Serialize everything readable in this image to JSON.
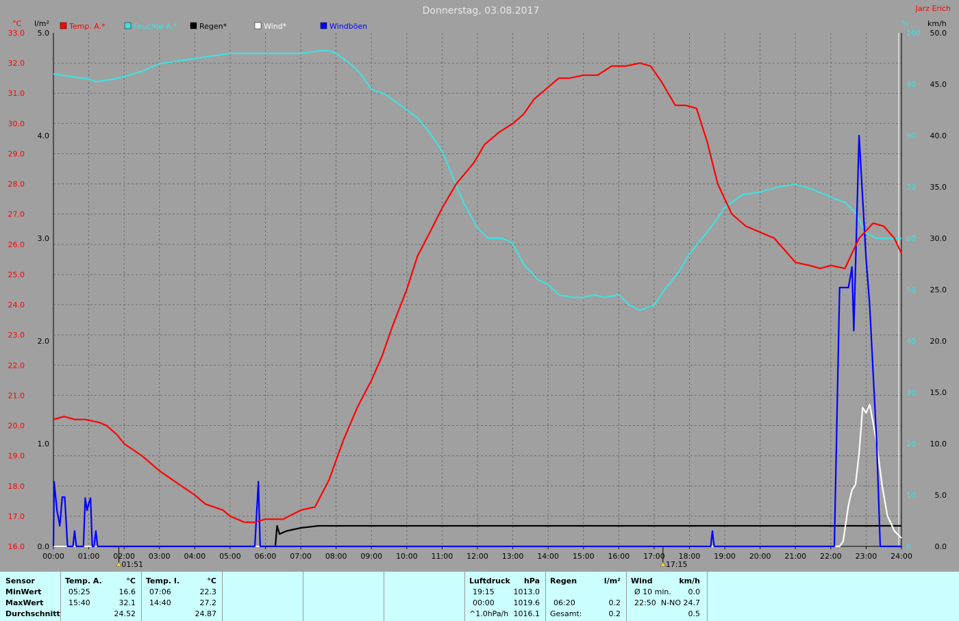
{
  "title": "Donnerstag, 03.08.2017",
  "author": "Jarz Erich",
  "axes": {
    "left1_unit": "°C",
    "left2_unit": "l/m²",
    "right1_unit": "%",
    "right2_unit": "km/h",
    "temp_ticks": [
      "16.0",
      "17.0",
      "18.0",
      "19.0",
      "20.0",
      "21.0",
      "22.0",
      "23.0",
      "24.0",
      "25.0",
      "26.0",
      "27.0",
      "28.0",
      "29.0",
      "30.0",
      "31.0",
      "32.0",
      "33.0"
    ],
    "rain_ticks": [
      "0.0",
      "1.0",
      "2.0",
      "3.0",
      "4.0",
      "5.0"
    ],
    "hum_ticks": [
      "0",
      "10",
      "20",
      "30",
      "40",
      "50",
      "60",
      "70",
      "80",
      "90",
      "100"
    ],
    "wind_ticks": [
      "0.0",
      "5.0",
      "10.0",
      "15.0",
      "20.0",
      "25.0",
      "30.0",
      "35.0",
      "40.0",
      "45.0",
      "50.0"
    ],
    "x_ticks": [
      "00:00",
      "01:00",
      "02:00",
      "03:00",
      "04:00",
      "05:00",
      "06:00",
      "07:00",
      "08:00",
      "09:00",
      "10:00",
      "11:00",
      "12:00",
      "13:00",
      "14:00",
      "15:00",
      "16:00",
      "17:00",
      "18:00",
      "19:00",
      "20:00",
      "21:00",
      "22:00",
      "23:00",
      "24:00"
    ],
    "sunrise": "01:51",
    "sunset": "17:15"
  },
  "legend": [
    {
      "name": "Temp. A.*",
      "color": "#ff0000"
    },
    {
      "name": "Feuchte A.*",
      "color": "#40e0e0"
    },
    {
      "name": "Regen*",
      "color": "#000000"
    },
    {
      "name": "Wind*",
      "color": "#ffffff"
    },
    {
      "name": "Windböen",
      "color": "#0000ff"
    }
  ],
  "chart_data": {
    "type": "line",
    "title": "Donnerstag, 03.08.2017",
    "x_unit": "hour of day",
    "xlim": [
      0,
      24
    ],
    "series": [
      {
        "name": "Temp. A.*",
        "axis": "°C",
        "ylim": [
          16,
          33
        ],
        "color": "#ff0000",
        "points": [
          [
            0,
            20.2
          ],
          [
            0.3,
            20.3
          ],
          [
            0.6,
            20.2
          ],
          [
            0.9,
            20.2
          ],
          [
            1.3,
            20.1
          ],
          [
            1.5,
            20.0
          ],
          [
            1.8,
            19.7
          ],
          [
            2.0,
            19.4
          ],
          [
            2.5,
            19.0
          ],
          [
            3.0,
            18.5
          ],
          [
            3.5,
            18.1
          ],
          [
            4.0,
            17.7
          ],
          [
            4.3,
            17.4
          ],
          [
            4.8,
            17.2
          ],
          [
            5.0,
            17.0
          ],
          [
            5.4,
            16.8
          ],
          [
            5.7,
            16.8
          ],
          [
            6.0,
            16.9
          ],
          [
            6.5,
            16.9
          ],
          [
            7.0,
            17.2
          ],
          [
            7.4,
            17.3
          ],
          [
            7.8,
            18.2
          ],
          [
            8.2,
            19.5
          ],
          [
            8.6,
            20.6
          ],
          [
            9.0,
            21.5
          ],
          [
            9.3,
            22.3
          ],
          [
            9.6,
            23.3
          ],
          [
            10.0,
            24.5
          ],
          [
            10.3,
            25.6
          ],
          [
            10.7,
            26.5
          ],
          [
            11.0,
            27.2
          ],
          [
            11.4,
            28.0
          ],
          [
            11.9,
            28.7
          ],
          [
            12.2,
            29.3
          ],
          [
            12.6,
            29.7
          ],
          [
            13.0,
            30.0
          ],
          [
            13.3,
            30.3
          ],
          [
            13.6,
            30.8
          ],
          [
            14.0,
            31.2
          ],
          [
            14.3,
            31.5
          ],
          [
            14.6,
            31.5
          ],
          [
            15.0,
            31.6
          ],
          [
            15.4,
            31.6
          ],
          [
            15.8,
            31.9
          ],
          [
            16.2,
            31.9
          ],
          [
            16.6,
            32.0
          ],
          [
            16.9,
            31.9
          ],
          [
            17.2,
            31.4
          ],
          [
            17.6,
            30.6
          ],
          [
            17.9,
            30.6
          ],
          [
            18.2,
            30.5
          ],
          [
            18.5,
            29.4
          ],
          [
            18.8,
            28.0
          ],
          [
            19.2,
            27.0
          ],
          [
            19.6,
            26.6
          ],
          [
            20.0,
            26.4
          ],
          [
            20.4,
            26.2
          ],
          [
            20.7,
            25.8
          ],
          [
            21.0,
            25.4
          ],
          [
            21.4,
            25.3
          ],
          [
            21.7,
            25.2
          ],
          [
            22.0,
            25.3
          ],
          [
            22.4,
            25.2
          ],
          [
            22.8,
            26.2
          ],
          [
            23.2,
            26.7
          ],
          [
            23.5,
            26.6
          ],
          [
            23.8,
            26.2
          ],
          [
            24.0,
            25.7
          ]
        ]
      },
      {
        "name": "Feuchte A.*",
        "axis": "%",
        "ylim": [
          0,
          100
        ],
        "color": "#40e0e0",
        "points": [
          [
            0,
            92
          ],
          [
            0.5,
            91.5
          ],
          [
            1.0,
            91
          ],
          [
            1.2,
            90.5
          ],
          [
            1.7,
            91
          ],
          [
            2.0,
            91.5
          ],
          [
            2.5,
            92.5
          ],
          [
            3.0,
            94
          ],
          [
            3.5,
            94.5
          ],
          [
            4.0,
            95
          ],
          [
            4.5,
            95.5
          ],
          [
            5.0,
            96
          ],
          [
            5.5,
            96
          ],
          [
            6.0,
            96
          ],
          [
            6.5,
            96
          ],
          [
            7.0,
            96
          ],
          [
            7.5,
            96.5
          ],
          [
            7.8,
            96.5
          ],
          [
            8.0,
            96
          ],
          [
            8.4,
            94
          ],
          [
            8.7,
            92
          ],
          [
            9.0,
            89
          ],
          [
            9.4,
            88
          ],
          [
            9.7,
            86.5
          ],
          [
            10.0,
            85
          ],
          [
            10.3,
            83.5
          ],
          [
            10.6,
            81
          ],
          [
            11.0,
            77
          ],
          [
            11.3,
            72
          ],
          [
            11.6,
            67
          ],
          [
            12.0,
            62
          ],
          [
            12.3,
            60
          ],
          [
            12.7,
            60
          ],
          [
            13.0,
            59
          ],
          [
            13.3,
            55
          ],
          [
            13.7,
            52
          ],
          [
            14.0,
            51
          ],
          [
            14.3,
            49
          ],
          [
            14.7,
            48.5
          ],
          [
            15.0,
            48.5
          ],
          [
            15.3,
            49
          ],
          [
            15.6,
            48.5
          ],
          [
            16.0,
            49
          ],
          [
            16.3,
            47
          ],
          [
            16.6,
            46
          ],
          [
            17.0,
            47
          ],
          [
            17.3,
            50
          ],
          [
            17.7,
            53.5
          ],
          [
            18.0,
            57
          ],
          [
            18.3,
            59.5
          ],
          [
            18.7,
            63
          ],
          [
            19.0,
            66
          ],
          [
            19.5,
            68.5
          ],
          [
            20.0,
            69
          ],
          [
            20.5,
            70
          ],
          [
            21.0,
            70.5
          ],
          [
            21.5,
            69.5
          ],
          [
            22.0,
            68
          ],
          [
            22.4,
            67
          ],
          [
            22.7,
            65
          ],
          [
            23.0,
            61
          ],
          [
            23.3,
            60
          ],
          [
            23.7,
            60
          ],
          [
            24.0,
            60
          ]
        ]
      },
      {
        "name": "Regen*",
        "axis": "l/m²",
        "ylim": [
          0,
          5
        ],
        "color": "#000000",
        "points": [
          [
            0,
            0
          ],
          [
            6.28,
            0
          ],
          [
            6.33,
            0.2
          ],
          [
            6.4,
            0.12
          ],
          [
            6.6,
            0.15
          ],
          [
            7.0,
            0.18
          ],
          [
            7.5,
            0.2
          ],
          [
            24.0,
            0.2
          ]
        ]
      },
      {
        "name": "Wind*",
        "axis": "km/h",
        "ylim": [
          0,
          50
        ],
        "color": "#ffffff",
        "points": [
          [
            0,
            0
          ],
          [
            22.25,
            0
          ],
          [
            22.35,
            0.5
          ],
          [
            22.5,
            4
          ],
          [
            22.6,
            5.5
          ],
          [
            22.7,
            6
          ],
          [
            22.8,
            9
          ],
          [
            22.9,
            13.5
          ],
          [
            23.0,
            13
          ],
          [
            23.1,
            13.8
          ],
          [
            23.2,
            12
          ],
          [
            23.3,
            10
          ],
          [
            23.45,
            6
          ],
          [
            23.6,
            3
          ],
          [
            23.8,
            1.5
          ],
          [
            24.0,
            0.8
          ]
        ]
      },
      {
        "name": "Windböen",
        "axis": "km/h",
        "ylim": [
          0,
          50
        ],
        "color": "#0000ff",
        "points": [
          [
            0,
            0
          ],
          [
            0.02,
            6.3
          ],
          [
            0.1,
            3.5
          ],
          [
            0.18,
            2
          ],
          [
            0.25,
            4.8
          ],
          [
            0.32,
            4.8
          ],
          [
            0.4,
            0
          ],
          [
            0.55,
            0
          ],
          [
            0.6,
            1.5
          ],
          [
            0.65,
            0
          ],
          [
            0.85,
            0
          ],
          [
            0.9,
            4.7
          ],
          [
            0.95,
            3.5
          ],
          [
            1.0,
            4.2
          ],
          [
            1.05,
            4.7
          ],
          [
            1.1,
            0
          ],
          [
            1.15,
            0
          ],
          [
            1.2,
            1.5
          ],
          [
            1.25,
            0
          ],
          [
            5.7,
            0
          ],
          [
            5.8,
            6.3
          ],
          [
            5.85,
            0
          ],
          [
            18.6,
            0
          ],
          [
            18.65,
            1.5
          ],
          [
            18.7,
            0
          ],
          [
            22.0,
            0
          ],
          [
            22.1,
            0
          ],
          [
            22.25,
            25.2
          ],
          [
            22.5,
            25.2
          ],
          [
            22.6,
            27.2
          ],
          [
            22.65,
            21
          ],
          [
            22.8,
            40
          ],
          [
            23.0,
            28
          ],
          [
            23.1,
            23.5
          ],
          [
            23.3,
            10
          ],
          [
            23.4,
            0
          ],
          [
            24.0,
            0
          ]
        ]
      }
    ]
  },
  "panel": {
    "sensor": {
      "h": "Sensor",
      "rows": [
        "MinWert",
        "MaxWert",
        "Durchschnitt"
      ]
    },
    "temp_a": {
      "h": "Temp. A.",
      "u": "°C",
      "min_t": "05:25",
      "min_v": "16.6",
      "max_t": "15:40",
      "max_v": "32.1",
      "avg": "24.52"
    },
    "temp_i": {
      "h": "Temp. I.",
      "u": "°C",
      "min_t": "07:06",
      "min_v": "22.3",
      "max_t": "14:40",
      "max_v": "27.2",
      "avg": "24.87"
    },
    "pressure": {
      "h": "Luftdruck",
      "u": "hPa",
      "min_t": "19:15",
      "min_v": "1013.0",
      "max_t": "00:00",
      "max_v": "1019.6",
      "avg_t": "^1.0hPa/h",
      "avg": "1016.1"
    },
    "rain": {
      "h": "Regen",
      "u": "l/m²",
      "max_t": "06:20",
      "max_v": "0.2",
      "total_l": "Gesamt:",
      "total": "0.2"
    },
    "wind": {
      "h": "Wind",
      "u": "km/h",
      "min_l": "Ø 10 min.",
      "min_v": "0.0",
      "max_t": "22:50",
      "max_v": "N-NO 24.7",
      "avg": "0.5"
    }
  }
}
